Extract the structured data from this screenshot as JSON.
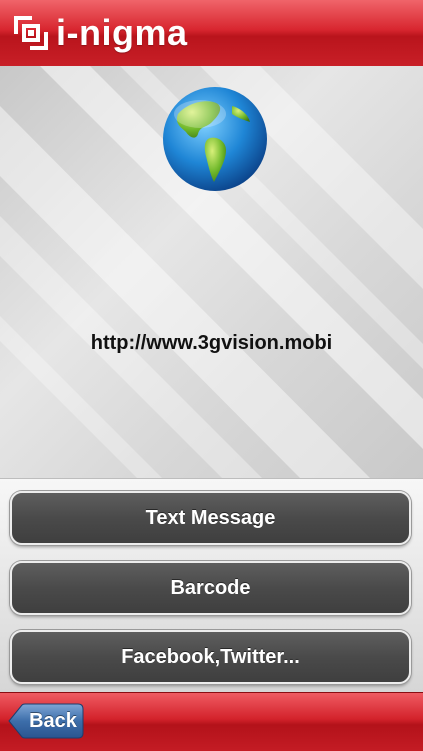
{
  "header": {
    "app_name": "i-nigma",
    "logo_icon": "inigma-logo-icon",
    "color": "#d8262f"
  },
  "content": {
    "icon": "globe-icon",
    "url": "http://www.3gvision.mobi"
  },
  "actions": [
    {
      "label": "Text Message"
    },
    {
      "label": "Barcode"
    },
    {
      "label": "Facebook,Twitter..."
    }
  ],
  "footer": {
    "back_label": "Back",
    "back_color": "#2f5f9a"
  }
}
